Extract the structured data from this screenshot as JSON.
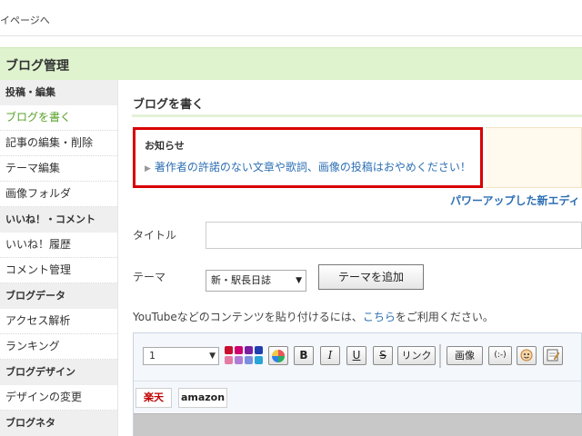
{
  "topbar": {
    "back_link": "イページへ"
  },
  "header": {
    "title": "ブログ管理"
  },
  "sidebar": {
    "sections": [
      {
        "title": "投稿・編集",
        "items": [
          "ブログを書く",
          "記事の編集・削除",
          "テーマ編集",
          "画像フォルダ"
        ]
      },
      {
        "title": "いいね！・コメント",
        "items": [
          "いいね！履歴",
          "コメント管理"
        ]
      },
      {
        "title": "ブログデータ",
        "items": [
          "アクセス解析",
          "ランキング"
        ]
      },
      {
        "title": "ブログデザイン",
        "items": [
          "デザインの変更"
        ]
      },
      {
        "title": "ブログネタ",
        "items": []
      }
    ],
    "active_item": "ブログを書く"
  },
  "main": {
    "page_title": "ブログを書く",
    "notice": {
      "title": "お知らせ",
      "message": "著作者の許諾のない文章や歌詞、画像の投稿はおやめください！"
    },
    "power_editor_link": "パワーアップした新エディ",
    "title_label": "タイトル",
    "title_value": "",
    "theme_label": "テーマ",
    "theme_selected": "新・駅長日誌",
    "theme_add_button": "テーマを追加",
    "youtube_prefix": "YouTubeなどのコンテンツを貼り付けるには、",
    "youtube_link": "こちら",
    "youtube_suffix": "をご利用ください。"
  },
  "editor": {
    "font_size": "1",
    "palette_colors": [
      "#c8102e",
      "#d0006f",
      "#7a1fa2",
      "#1f3fb0",
      "#e47ba5",
      "#b07cd8",
      "#7b8fe0",
      "#29a3d8"
    ],
    "buttons": {
      "bold": "B",
      "italic": "I",
      "underline": "U",
      "strike": "S",
      "link": "リンク",
      "image": "画像",
      "emoji": "(:-)"
    },
    "affiliates": {
      "rakuten": "楽天",
      "amazon": "amazon"
    }
  },
  "colors": {
    "accent_green": "#5aa12a",
    "header_bg": "#dff3cf",
    "notice_border": "#d80000",
    "link_blue": "#2d6fb3"
  }
}
